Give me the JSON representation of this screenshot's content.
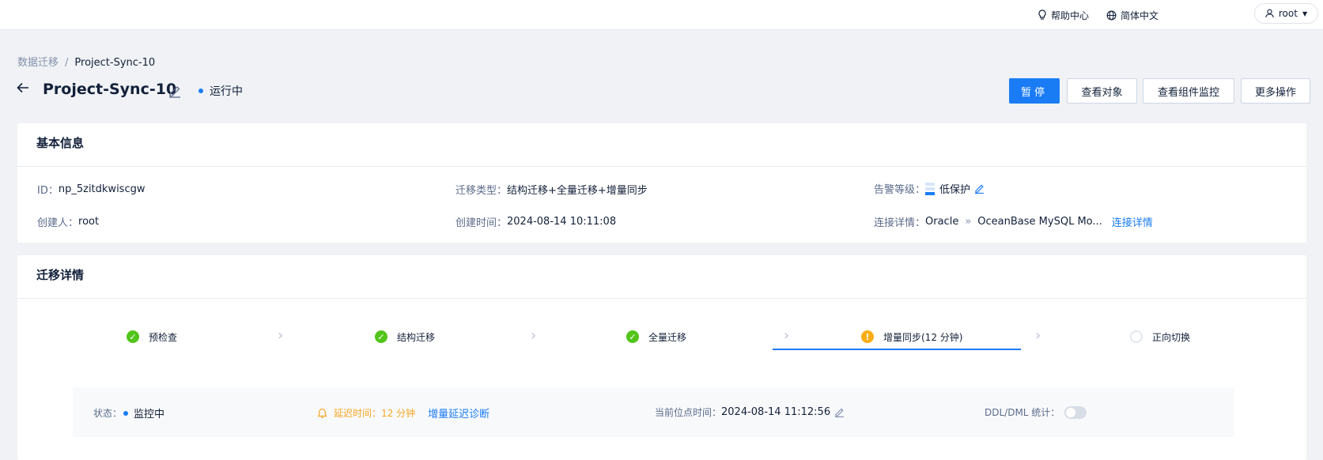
{
  "topbar": {
    "help": "帮助中心",
    "language": "简体中文",
    "user": "root"
  },
  "breadcrumb": {
    "parent": "数据迁移",
    "separator": "/",
    "current": "Project-Sync-10"
  },
  "header": {
    "title": "Project-Sync-10",
    "status": "运行中",
    "status_color": "#1a7cf5"
  },
  "actions": {
    "pause": "暂停",
    "view_objects": "查看对象",
    "view_monitor": "查看组件监控",
    "more": "更多操作"
  },
  "basic_info": {
    "title": "基本信息",
    "id_label": "ID：",
    "id_value": "np_5zitdkwiscgw",
    "type_label": "迁移类型：",
    "type_value": "结构迁移+全量迁移+增量同步",
    "alarm_label": "告警等级：",
    "alarm_value": "低保护",
    "creator_label": "创建人：",
    "creator_value": "root",
    "created_label": "创建时间：",
    "created_value": "2024-08-14 10:11:08",
    "conn_label": "连接详情：",
    "conn_source": "Oracle",
    "conn_arrow": "»",
    "conn_target": "OceanBase MySQL Mo...",
    "conn_link": "连接详情"
  },
  "migration_detail": {
    "title": "迁移详情",
    "steps": [
      {
        "label": "预检查",
        "state": "done"
      },
      {
        "label": "结构迁移",
        "state": "done"
      },
      {
        "label": "全量迁移",
        "state": "done"
      },
      {
        "label": "增量同步(12 分钟)",
        "state": "warning"
      },
      {
        "label": "正向切换",
        "state": "pending"
      }
    ],
    "status_label": "状态：",
    "status_value": "监控中",
    "delay_text": "延迟时间：12 分钟",
    "delay_link": "增量延迟诊断",
    "position_label": "当前位点时间：",
    "position_value": "2024-08-14 11:12:56",
    "ddl_label": "DDL/DML 统计：",
    "ddl_toggle": "off"
  },
  "colors": {
    "primary": "#1a7cf5",
    "success": "#52c41a",
    "warning": "#faad14",
    "warning_text": "#f5a623"
  }
}
